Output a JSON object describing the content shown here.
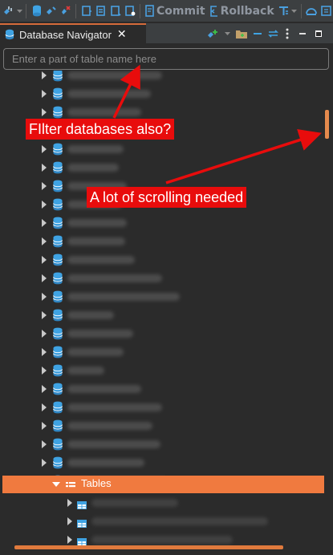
{
  "toolbar": {
    "commit_label": "Commit",
    "rollback_label": "Rollback"
  },
  "tab": {
    "title": "Database Navigator",
    "close_glyph": "✕"
  },
  "filter": {
    "value": "",
    "placeholder": "Enter a part of table name here"
  },
  "tree": {
    "expanded_folder_label": "Tables"
  },
  "annotations": {
    "filter_note": "FIlter databases also?",
    "scroll_note": "A lot of scrolling needed"
  },
  "colors": {
    "accent": "#f07a3f",
    "annotation": "#e80c0c",
    "db_icon": "#3fa3e3",
    "background": "#2b2b2b"
  },
  "icons": [
    "connect-icon",
    "disconnect-icon",
    "database-new-icon",
    "commit-icon",
    "rollback-icon",
    "transaction-mode-icon",
    "sql-editor-icon",
    "link-editor-icon",
    "collapse-all-icon",
    "view-menu-icon",
    "minimize-icon",
    "maximize-icon",
    "database-icon",
    "table-icon",
    "folder-icon"
  ]
}
